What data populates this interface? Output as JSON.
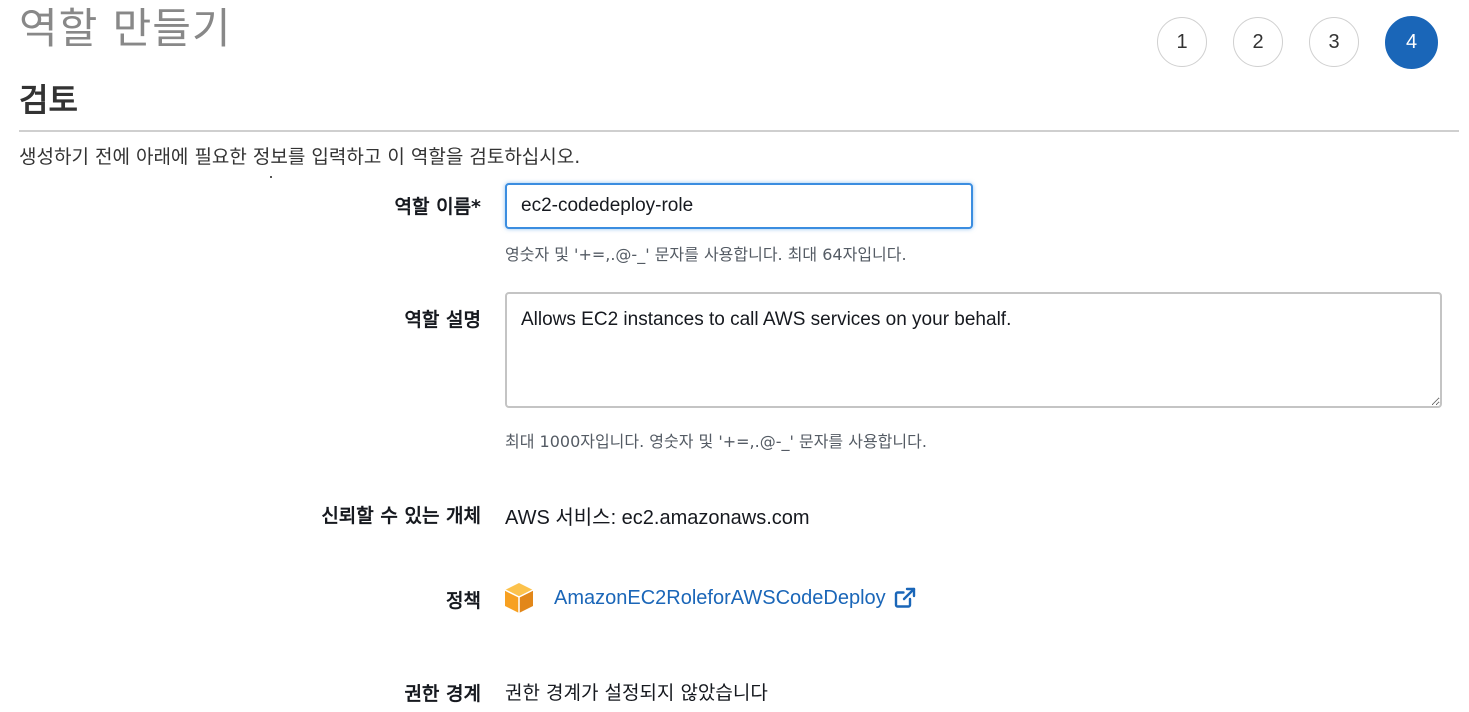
{
  "page": {
    "title": "역할 만들기",
    "steps": [
      "1",
      "2",
      "3",
      "4"
    ],
    "active_step": "4"
  },
  "section": {
    "title": "검토",
    "intro": "생성하기 전에 아래에 필요한 정보를 입력하고 이 역할을 검토하십시오."
  },
  "form": {
    "role_name": {
      "label": "역할 이름*",
      "value": "ec2-codedeploy-role",
      "hint": "영숫자 및 '+=,.@-_' 문자를 사용합니다. 최대 64자입니다."
    },
    "role_description": {
      "label": "역할 설명",
      "value": "Allows EC2 instances to call AWS services on your behalf.",
      "hint": "최대 1000자입니다. 영숫자 및 '+=,.@-_' 문자를 사용합니다."
    },
    "trusted_entities": {
      "label": "신뢰할 수 있는 개체",
      "value": "AWS 서비스: ec2.amazonaws.com"
    },
    "policies": {
      "label": "정책",
      "items": [
        {
          "name": "AmazonEC2RoleforAWSCodeDeploy",
          "icon": "aws-managed-policy-cube-icon"
        }
      ],
      "external_link_icon": "external-link-icon"
    },
    "permissions_boundary": {
      "label": "권한 경계",
      "value": "권한 경계가 설정되지 않았습니다"
    }
  },
  "colors": {
    "accent": "#1a66b8",
    "input_focus": "#3b8de0",
    "policy_icon": "#f7a021",
    "hint": "#545b64",
    "title": "#888888"
  }
}
